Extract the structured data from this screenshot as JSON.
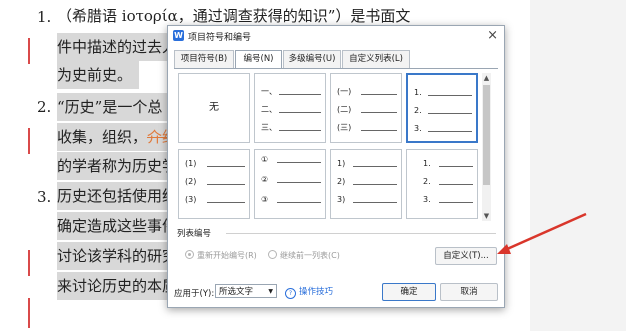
{
  "document": {
    "lines": [
      {
        "num": "1.",
        "text": "（希腊语 ioτορία，通过调查获得的知识”）是书面文"
      },
      {
        "num": "",
        "text": "件中描述的过去人"
      },
      {
        "num": "",
        "text": "为史前史。"
      },
      {
        "num": "2.",
        "text": "“历史”是一个总"
      },
      {
        "num": "",
        "text": "收集，组织，",
        "strike": "介绍"
      },
      {
        "num": "",
        "text": "的学者称为历史学"
      },
      {
        "num": "3.",
        "text": "历史还包括使用统"
      },
      {
        "num": "",
        "text": "确定造成这些事件"
      },
      {
        "num": "",
        "text": "讨论该学科的研究"
      },
      {
        "num": "",
        "text": "来讨论历史的本质"
      }
    ]
  },
  "dialog": {
    "title": "项目符号和编号",
    "app_icon": "W",
    "close": "×",
    "tabs": [
      {
        "label": "项目符号(B)"
      },
      {
        "label": "编号(N)"
      },
      {
        "label": "多级编号(U)"
      },
      {
        "label": "自定义列表(L)"
      }
    ],
    "active_tab": "编号(N)",
    "none_label": "无",
    "styles": [
      [
        "一、",
        "二、",
        "三、"
      ],
      [
        "(一)",
        "(二)",
        "(三)"
      ],
      [
        "1.",
        "2.",
        "3."
      ],
      [
        "(1)",
        "(2)",
        "(3)"
      ],
      [
        "①",
        "②",
        "③"
      ],
      [
        "1)",
        "2)",
        "3)"
      ],
      [
        "1.",
        "2.",
        "3."
      ]
    ],
    "list_section": "列表编号",
    "radio_restart": "重新开始编号(R)",
    "radio_continue": "继续前一列表(C)",
    "customize_button": "自定义(T)...",
    "apply_to_label": "应用于(Y):",
    "apply_to_value": "所选文字",
    "tips_link": "操作技巧",
    "ok_button": "确定",
    "cancel_button": "取消"
  },
  "colors": {
    "arrow": "#d9362b",
    "accent": "#3a78c9"
  }
}
